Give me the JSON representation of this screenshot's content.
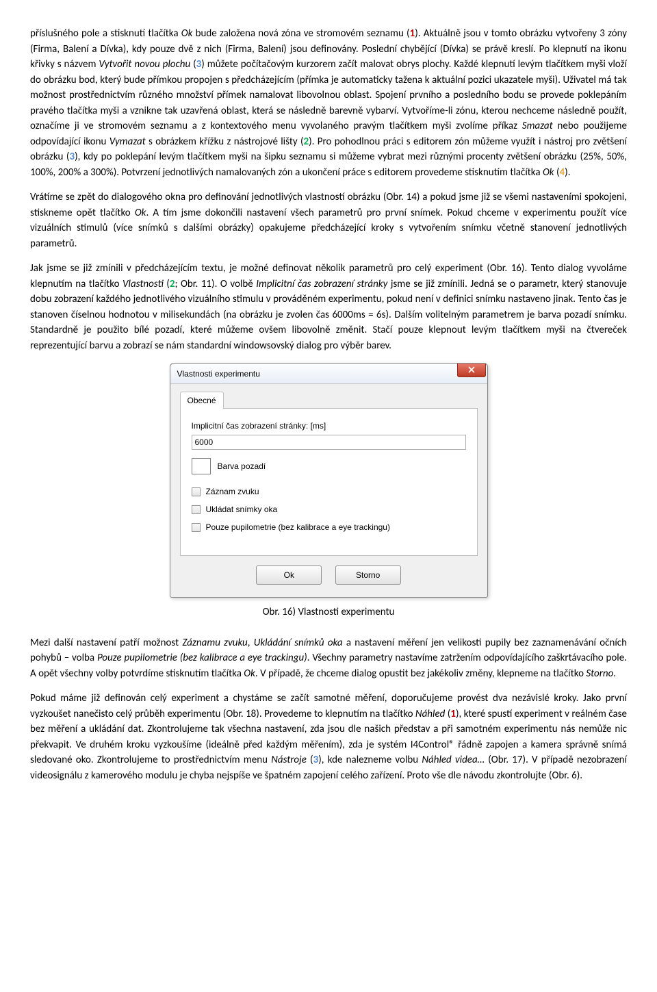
{
  "para1": {
    "t1": "příslušného pole a stisknutí tlačítka ",
    "ok1": "Ok",
    "t2": " bude založena nová zóna ve stromovém seznamu (",
    "t3": "). Aktuálně jsou v tomto obrázku vytvořeny 3 zóny (Firma, Balení a Dívka), kdy pouze dvě z nich (Firma, Balení) jsou definovány. Poslední chybějící (Dívka) se právě kreslí. Po klepnutí na ikonu křivky s názvem ",
    "i1": "Vytvořit novou plochu",
    "t4": " (",
    "t5": ") můžete počítačovým kurzorem začít malovat obrys plochy. Každé klepnutí levým tlačítkem myši vloží do obrázku bod, který bude přímkou propojen s předcházejícím (přímka je automaticky tažena k aktuální pozici ukazatele myši). Uživatel má tak možnost prostřednictvím různého množství přímek namalovat libovolnou oblast. Spojení prvního a posledního bodu se provede poklepáním pravého tlačítka myši a vznikne tak uzavřená oblast, která se následně barevně vybarví. Vytvoříme-li zónu, kterou nechceme následně použít, označíme ji ve stromovém seznamu a z kontextového menu vyvolaného pravým tlačítkem myši zvolíme příkaz ",
    "i2": "Smazat",
    "t6": " nebo použijeme odpovídající ikonu ",
    "i3": "Vymazat",
    "t7": " s obrázkem křížku z nástrojové lišty (",
    "t8": "). Pro pohodlnou práci s editorem zón můžeme využít i nástroj pro zvětšení obrázku (",
    "t9": "), kdy po poklepání levým tlačítkem myši na šipku seznamu si můžeme vybrat mezi různými procenty zvětšení obrázku (25%, 50%, 100%, 200% a 300%). Potvrzení jednotlivých namalovaných zón a ukončení práce s editorem provedeme stisknutím tlačítka ",
    "ok2": "Ok",
    "t10": " (",
    "t11": ")."
  },
  "refs": {
    "r1": "1",
    "r2": "2",
    "r3": "3",
    "r4": "4"
  },
  "para2": {
    "t1": "Vrátíme se zpět do dialogového okna pro definování jednotlivých vlastností obrázku (Obr. 14) a pokud jsme již se všemi nastaveními spokojeni, stiskneme opět tlačítko ",
    "ok": "Ok",
    "t2": ". A tím jsme dokončili nastavení všech parametrů pro první snímek. Pokud chceme v experimentu použít více vizuálních stimulů (více snímků s dalšími obrázky) opakujeme předcházející kroky s vytvořením snímku včetně stanovení jednotlivých parametrů."
  },
  "para3": {
    "t1": "Jak jsme se již zmínili v předcházejícím textu, je možné definovat několik parametrů pro celý experiment (Obr. 16). Tento dialog vyvoláme klepnutím na tlačítko ",
    "i1": "Vlastnosti",
    "t2": " (",
    "t3": "; Obr. 11). O volbě ",
    "i2": "Implicitní čas zobrazení stránky",
    "t4": " jsme se již zmínili. Jedná se o parametr, který stanovuje dobu zobrazení každého jednotlivého vizuálního stimulu v prováděném experimentu, pokud není v definici snímku nastaveno jinak. Tento čas je stanoven číselnou hodnotou v milisekundách (na obrázku je zvolen čas 6000ms = 6s). Dalším volitelným parametrem je barva pozadí snímku. Standardně je použito bílé pozadí, které můžeme ovšem libovolně změnit. Stačí pouze klepnout levým tlačítkem myši na čtvereček reprezentující barvu a zobrazí se nám standardní windowsovský dialog pro výběr barev."
  },
  "dialog": {
    "title": "Vlastnosti experimentu",
    "tab": "Obecné",
    "implicit_label": "Implicitní čas zobrazení stránky: [ms]",
    "implicit_value": "6000",
    "bg_label": "Barva pozadí",
    "chk_sound": "Záznam zvuku",
    "chk_save_eye": "Ukládat snímky oka",
    "chk_pupil": "Pouze pupilometrie (bez kalibrace a eye trackingu)",
    "btn_ok": "Ok",
    "btn_cancel": "Storno"
  },
  "caption": "Obr. 16) Vlastnosti experimentu",
  "para4": {
    "t1": "Mezi další nastavení patří možnost ",
    "i1": "Záznamu zvuku",
    "t2": ", ",
    "i2": "Ukládání snímků oka",
    "t3": " a nastavení měření jen velikosti pupily bez zaznamenávání očních pohybů – volba ",
    "i3": "Pouze pupilometrie (bez kalibrace a eye trackingu)",
    "t4": ". Všechny parametry nastavíme zatržením odpovídajícího zaškrtávacího pole. A opět všechny volby potvrdíme stisknutím tlačítka ",
    "ok": "Ok",
    "t5": ". V případě, že chceme dialog opustit bez jakékoliv změny, klepneme na tlačítko ",
    "i4": "Storno",
    "t6": "."
  },
  "para5": {
    "t1": "Pokud máme již definován celý experiment a chystáme se začít samotné měření, doporučujeme provést dva nezávislé kroky. Jako první vyzkoušet nanečisto celý průběh experimentu (Obr. 18). Provedeme to klepnutím na tlačítko ",
    "i1": "Náhled",
    "t2": " (",
    "t3": "), které spustí experiment v reálném čase bez měření a ukládání dat. Zkontrolujeme tak všechna nastavení, zda jsou dle našich představ a při samotném experimentu nás nemůže nic překvapit. Ve druhém kroku vyzkoušíme (ideálně před každým měřením), zda je systém I4Control® řádně zapojen a kamera správně snímá sledované oko. Zkontrolujeme to prostřednictvím menu ",
    "i2": "Nástroje",
    "t4": " (",
    "t5": "), kde nalezneme volbu ",
    "i3": "Náhled videa…",
    "t6": " (Obr. 17). V případě nezobrazení videosignálu z kamerového modulu je chyba nejspíše ve špatném zapojení celého zařízení. Proto vše dle návodu zkontrolujte (Obr. 6)."
  }
}
